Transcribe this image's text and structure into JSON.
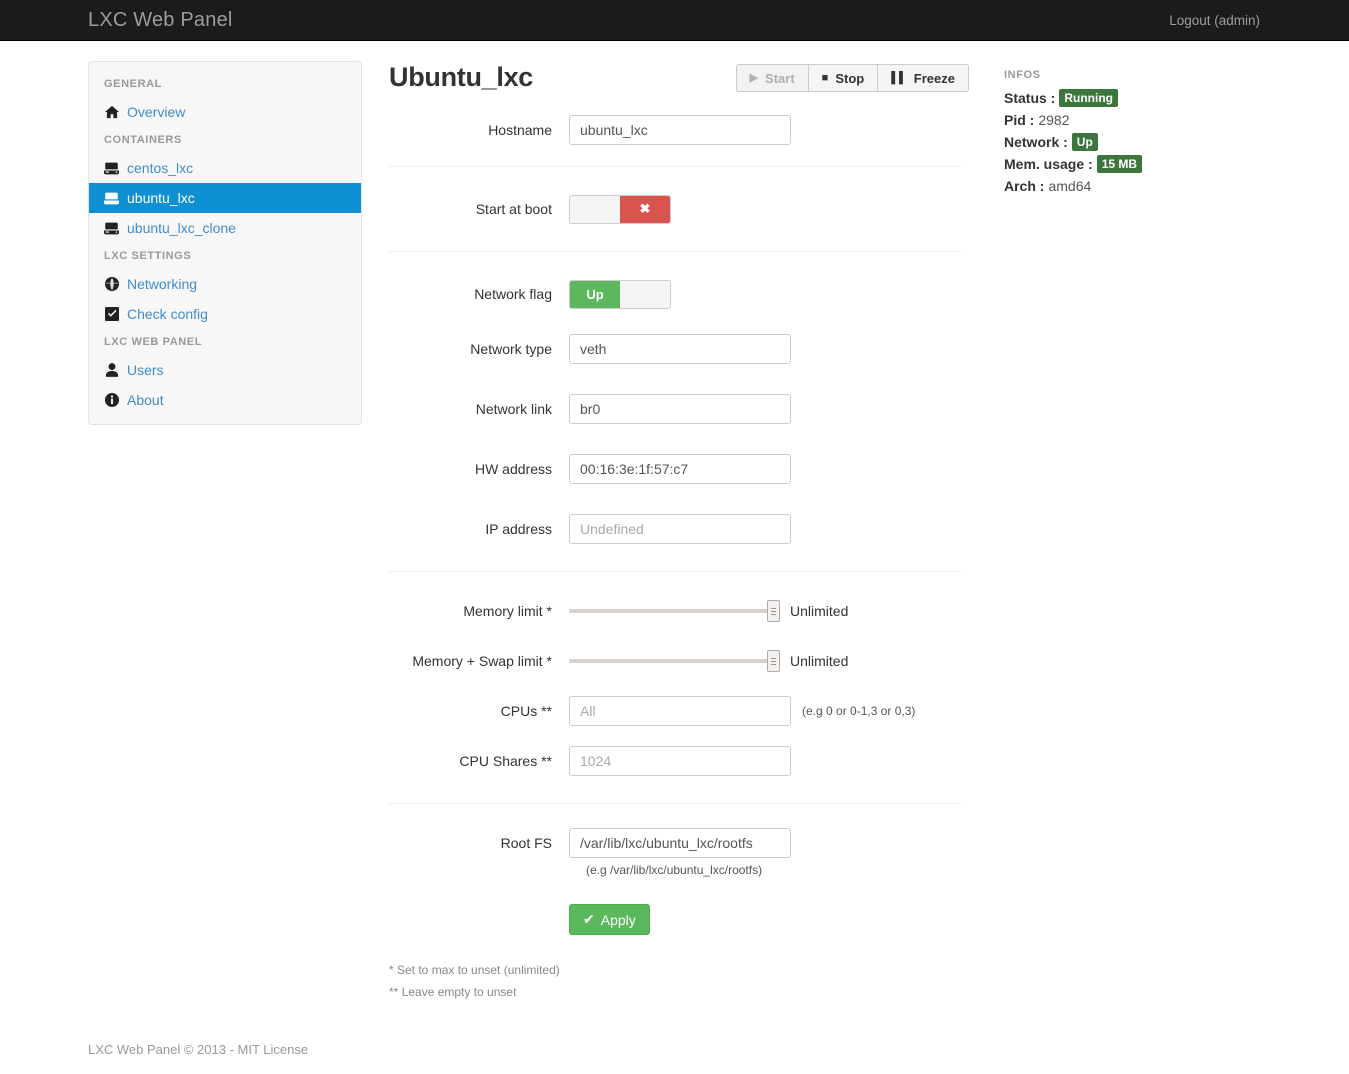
{
  "navbar": {
    "brand": "LXC Web Panel",
    "logout": "Logout (admin)"
  },
  "sidebar": {
    "groups": [
      {
        "header": "GENERAL",
        "items": [
          {
            "label": "Overview",
            "icon": "home-icon",
            "active": false
          }
        ]
      },
      {
        "header": "CONTAINERS",
        "items": [
          {
            "label": "centos_lxc",
            "icon": "server-icon",
            "active": false
          },
          {
            "label": "ubuntu_lxc",
            "icon": "server-icon",
            "active": true
          },
          {
            "label": "ubuntu_lxc_clone",
            "icon": "server-icon",
            "active": false
          }
        ]
      },
      {
        "header": "LXC SETTINGS",
        "items": [
          {
            "label": "Networking",
            "icon": "globe-icon",
            "active": false
          },
          {
            "label": "Check config",
            "icon": "check-square-icon",
            "active": false
          }
        ]
      },
      {
        "header": "LXC WEB PANEL",
        "items": [
          {
            "label": "Users",
            "icon": "user-icon",
            "active": false
          },
          {
            "label": "About",
            "icon": "info-circle-icon",
            "active": false
          }
        ]
      }
    ]
  },
  "main": {
    "title": "Ubuntu_lxc",
    "buttons": {
      "start": "Start",
      "stop": "Stop",
      "freeze": "Freeze"
    },
    "fields": {
      "hostname_label": "Hostname",
      "hostname_value": "ubuntu_lxc",
      "start_at_boot_label": "Start at boot",
      "start_at_boot_state": "off",
      "start_at_boot_glyph": "✖",
      "network_flag_label": "Network flag",
      "network_flag_state": "on",
      "network_flag_text": "Up",
      "network_type_label": "Network type",
      "network_type_value": "veth",
      "network_link_label": "Network link",
      "network_link_value": "br0",
      "hw_address_label": "HW address",
      "hw_address_value": "00:16:3e:1f:57:c7",
      "ip_address_label": "IP address",
      "ip_address_placeholder": "Undefined",
      "memory_limit_label": "Memory limit *",
      "memory_limit_value": "Unlimited",
      "memory_swap_label": "Memory + Swap limit *",
      "memory_swap_value": "Unlimited",
      "cpus_label": "CPUs **",
      "cpus_placeholder": "All",
      "cpus_hint": "(e.g 0 or 0-1,3 or 0,3)",
      "cpu_shares_label": "CPU Shares **",
      "cpu_shares_placeholder": "1024",
      "rootfs_label": "Root FS",
      "rootfs_value": "/var/lib/lxc/ubuntu_lxc/rootfs",
      "rootfs_hint": "(e.g /var/lib/lxc/ubuntu_lxc/rootfs)"
    },
    "apply_label": "Apply",
    "footnotes": [
      "* Set to max to unset (unlimited)",
      "** Leave empty to unset"
    ]
  },
  "infos": {
    "title": "INFOS",
    "status_label": "Status :",
    "status_value": "Running",
    "pid_label": "Pid :",
    "pid_value": "2982",
    "network_label": "Network :",
    "network_value": "Up",
    "mem_label": "Mem. usage :",
    "mem_value": "15 MB",
    "arch_label": "Arch :",
    "arch_value": "amd64"
  },
  "footer": {
    "text": "LXC Web Panel © 2013 - MIT License"
  },
  "colors": {
    "navbar_bg": "#1b1b1b",
    "accent_blue": "#0e90d2",
    "link_blue": "#428bca",
    "green": "#5cb85c",
    "red": "#d9534f",
    "badge_green": "#3c763d"
  }
}
